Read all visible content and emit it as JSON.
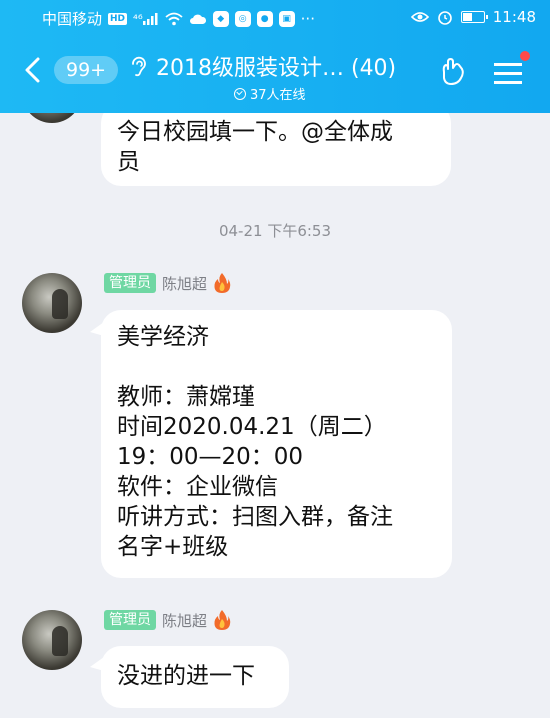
{
  "status_bar": {
    "carrier": "中国移动",
    "hd": "HD",
    "signal": "⁴⁶",
    "time": "11:48"
  },
  "nav": {
    "unread_count": "99+",
    "title": "2018级服装设计…  (40)",
    "online": "37人在线"
  },
  "messages": {
    "prev_bubble_text": "今日校园填一下。@全体成\n员",
    "timestamp": "04-21 下午6:53",
    "msg1": {
      "role": "管理员",
      "sender": "陈旭超",
      "text": "美学经济\n\n教师：萧嫦瑾\n时间2020.04.21（周二）\n19：00—20：00\n软件：企业微信\n听讲方式：扫图入群，备注\n名字+班级"
    },
    "msg2": {
      "role": "管理员",
      "sender": "陈旭超",
      "text": "没进的进一下"
    }
  },
  "colors": {
    "header": "#12a8f0",
    "background": "#eef0f5",
    "badge_green": "#6fd7a3",
    "notification_red": "#ff4a4a"
  },
  "icons": [
    "back-chevron-icon",
    "ear-icon",
    "online-check-icon",
    "hand-gesture-icon",
    "menu-icon",
    "flame-icon"
  ]
}
